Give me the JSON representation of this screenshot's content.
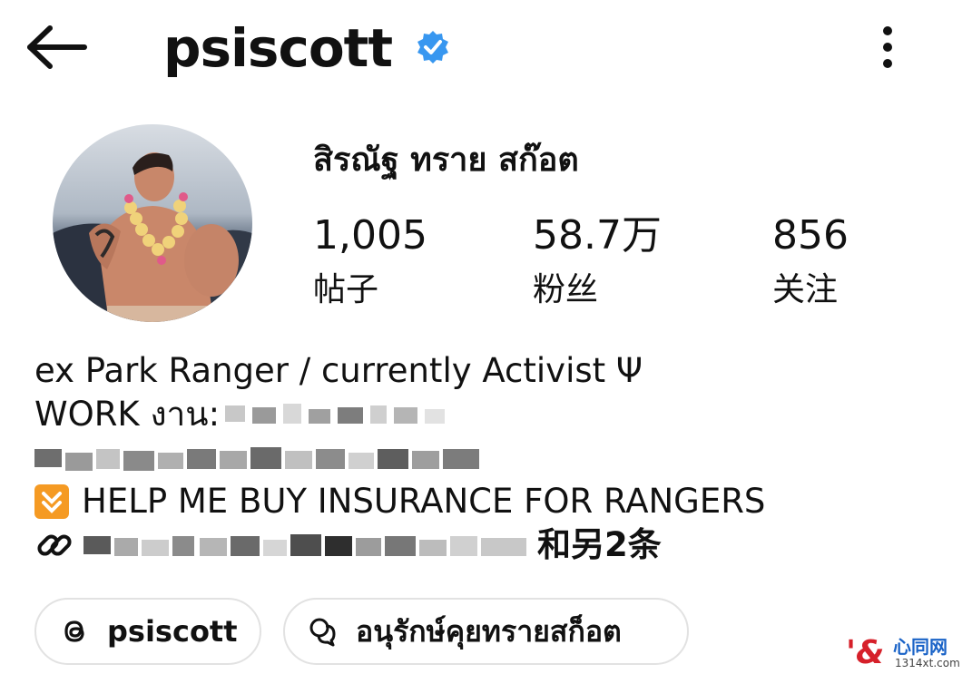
{
  "header": {
    "username": "psiscott",
    "back_icon": "arrow-left-icon",
    "verified_icon": "verified-badge-icon",
    "more_icon": "more-vertical-icon"
  },
  "profile": {
    "full_name": "สิรณัฐ ทราย สก๊อต",
    "stats": {
      "posts": {
        "value": "1,005",
        "label": "帖子"
      },
      "followers": {
        "value": "58.7万",
        "label": "粉丝"
      },
      "following": {
        "value": "856",
        "label": "关注"
      }
    }
  },
  "bio": {
    "line1": "ex Park Ranger / currently Activist  Ψ",
    "line2_prefix": "WORK งาน:",
    "line4": "HELP ME BUY INSURANCE FOR RANGERS",
    "line5_suffix": "和另2条"
  },
  "buttons": {
    "threads_label": "psiscott",
    "chat_label": "อนุรักษ์คุยทรายสก็อต"
  },
  "watermark": {
    "logo": "'&",
    "name": "心同网",
    "url": "1314xt.com"
  },
  "colors": {
    "verified": "#3897f0",
    "warning": "#f59a23",
    "pill_border": "#e2e2e2"
  }
}
